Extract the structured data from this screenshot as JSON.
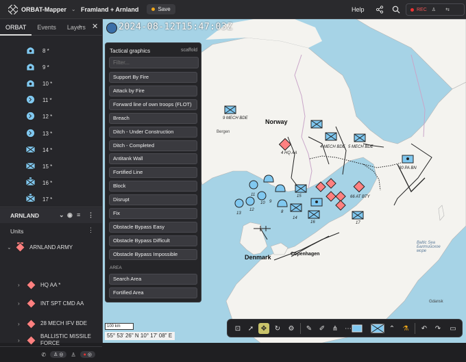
{
  "app": {
    "name": "ORBAT-Mapper",
    "scenario": "Framland + Arnland",
    "save_label": "Save",
    "help_label": "Help",
    "rec_label": "REC"
  },
  "colors": {
    "friendly": "#80c8f0",
    "hostile": "#ff8080",
    "accent": "#c9c36a"
  },
  "sidebar": {
    "tabs": [
      "ORBAT",
      "Events",
      "Layers"
    ],
    "unit_items": [
      {
        "label": "8 *",
        "icon": "infantry-dome-icon"
      },
      {
        "label": "9 *",
        "icon": "infantry-dome-icon"
      },
      {
        "label": "10 *",
        "icon": "infantry-dome-icon"
      },
      {
        "label": "11 *",
        "icon": "recon-circle-icon"
      },
      {
        "label": "12 *",
        "icon": "recon-circle-icon"
      },
      {
        "label": "13 *",
        "icon": "recon-circle-icon"
      },
      {
        "label": "14 *",
        "icon": "infantry-box-icon"
      },
      {
        "label": "15 *",
        "icon": "infantry-box-icon"
      },
      {
        "label": "16 *",
        "icon": "mech-box-icon"
      },
      {
        "label": "17 *",
        "icon": "mech-box-icon"
      }
    ],
    "side_name": "ARNLAND",
    "units_header": "Units",
    "orbat_rows": [
      {
        "label": "ARNLAND ARMY"
      },
      {
        "label": "HQ AA *"
      },
      {
        "label": "INT SPT CMD AA"
      },
      {
        "label": "28 MECH IFV BDE"
      },
      {
        "label": "BALLISTIC MISSILE FORCE"
      }
    ]
  },
  "map": {
    "timestamp": "2024-08-12T15:47:03Z",
    "labels": {
      "norway": "Norway",
      "denmark": "Denmark",
      "copenhagen": "Copenhagen",
      "bergen": "Bergen",
      "baltic": "Baltic Sea\nБалтийское\nморе",
      "gdansk": "Gdansk"
    },
    "units": [
      "9 MECH BDE",
      "4 MECH BDE",
      "5 MECH BDE",
      "4 HQ AA",
      "66 AT BTY",
      "30 PA BN",
      "11",
      "12",
      "13",
      "10",
      "9",
      "8",
      "14",
      "15",
      "16",
      "17"
    ],
    "scale": "100 km",
    "coordinates": "55° 53' 26\" N 10° 17' 08\" E"
  },
  "tactical_panel": {
    "title": "Tactical graphics",
    "tag": "scaffold",
    "filter_placeholder": "Filter...",
    "items": [
      "Support By Fire",
      "Attack by Fire",
      "Forward line of own troops (FLOT)",
      "Breach",
      "Ditch - Under Construction",
      "Ditch - Completed",
      "Antitank Wall",
      "Fortified Line",
      "Block",
      "Disrupt",
      "Fix",
      "Obstacle Bypass Easy",
      "Obstacle Bypass Difficult",
      "Obstacle Bypass Impossible"
    ],
    "area_header": "AREA",
    "area_items": [
      "Search Area",
      "Fortified Area"
    ]
  }
}
